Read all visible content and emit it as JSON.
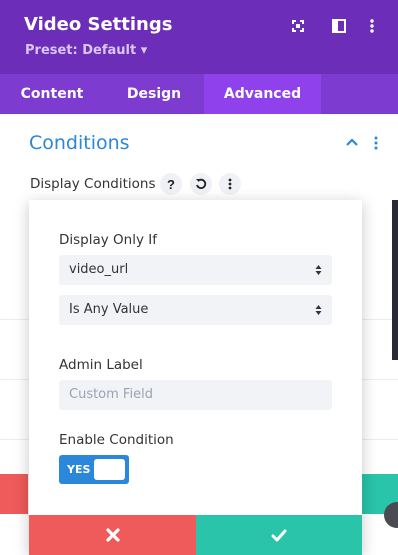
{
  "header": {
    "title": "Video Settings",
    "preset": "Preset: Default ▾",
    "icons": [
      "expand-icon",
      "split-view-icon",
      "more-vertical-icon"
    ]
  },
  "tabs": [
    {
      "label": "Content",
      "active": false
    },
    {
      "label": "Design",
      "active": false
    },
    {
      "label": "Advanced",
      "active": true
    }
  ],
  "section": {
    "title": "Conditions",
    "display_conditions_label": "Display Conditions",
    "help_glyph": "?",
    "icons": [
      "chevron-up-icon",
      "more-vertical-icon",
      "help-icon",
      "reset-icon",
      "options-icon"
    ]
  },
  "modal": {
    "display_only_if_label": "Display Only If",
    "field_select_value": "video_url",
    "operator_select_value": "Is Any Value",
    "admin_label_label": "Admin Label",
    "admin_label_placeholder": "Custom Field",
    "enable_condition_label": "Enable Condition",
    "toggle_text": "YES",
    "toggle_on": true
  },
  "colors": {
    "header_bg": "#6c2eb9",
    "tabs_bg": "#7e3bd0",
    "tab_active_bg": "#8f42ec",
    "accent_blue": "#2b87da",
    "cancel_red": "#ef5a5a",
    "confirm_teal": "#29c4a9"
  }
}
